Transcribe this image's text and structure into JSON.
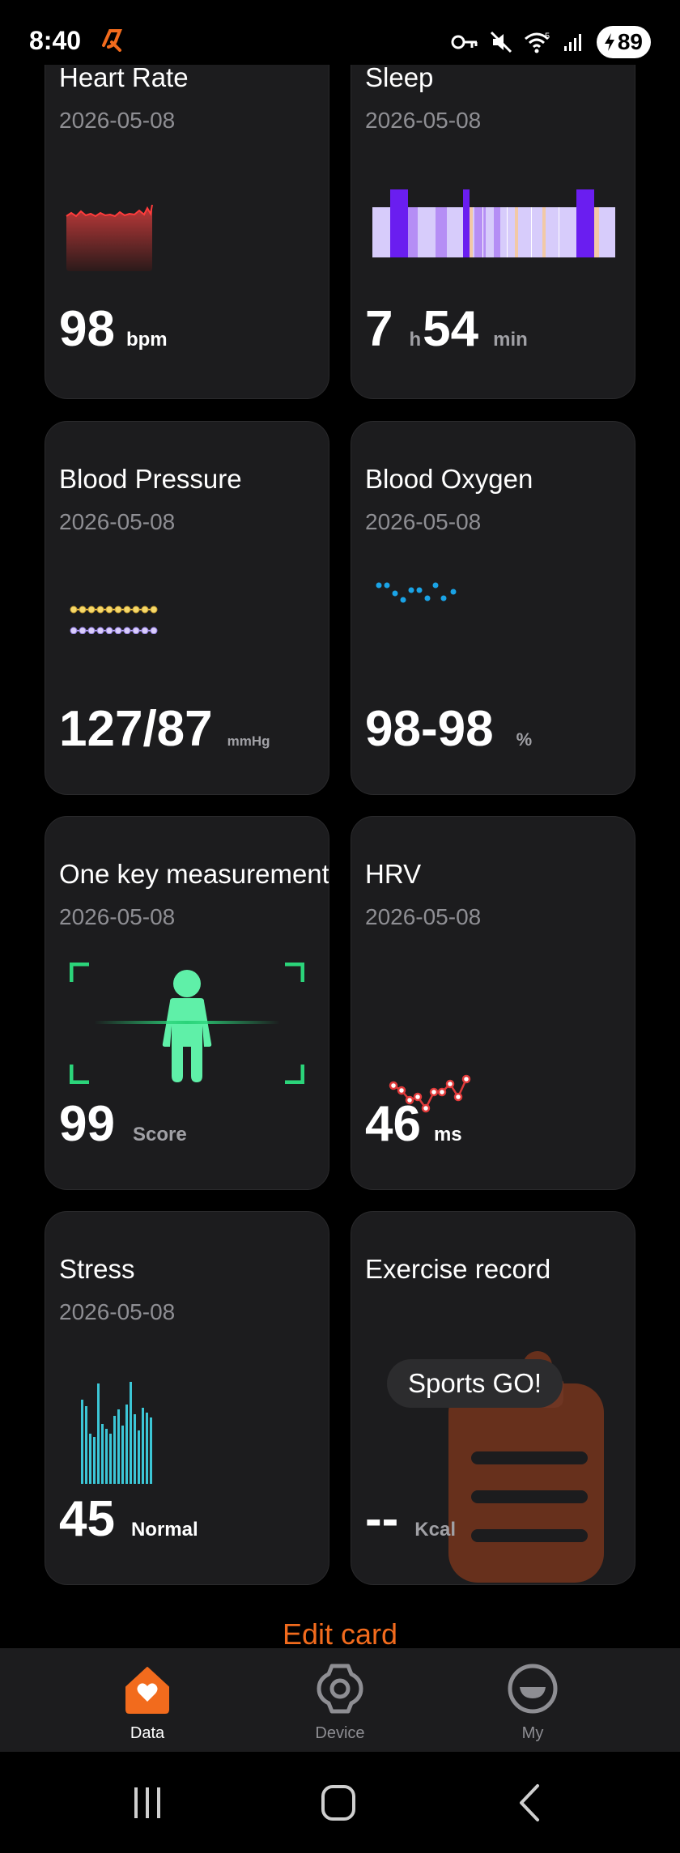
{
  "status": {
    "time": "8:40",
    "battery": "89",
    "network": "5"
  },
  "cards": {
    "heart_rate": {
      "title": "Heart Rate",
      "date": "2026-05-08",
      "value": "98",
      "unit": "bpm"
    },
    "sleep": {
      "title": "Sleep",
      "date": "2026-05-08",
      "hours": "7",
      "h_unit": "h",
      "minutes": "54",
      "min_unit": "min"
    },
    "blood_pressure": {
      "title": "Blood Pressure",
      "date": "2026-05-08",
      "value": "127/87",
      "unit": "mmHg"
    },
    "blood_oxygen": {
      "title": "Blood Oxygen",
      "date": "2026-05-08",
      "value": "98-98",
      "unit": "%"
    },
    "one_key": {
      "title": "One key measurement",
      "date": "2026-05-08",
      "value": "99",
      "unit": "Score"
    },
    "hrv": {
      "title": "HRV",
      "date": "2026-05-08",
      "value": "46",
      "unit": "ms"
    },
    "stress": {
      "title": "Stress",
      "date": "2026-05-08",
      "value": "45",
      "unit": "Normal"
    },
    "exercise": {
      "title": "Exercise record",
      "value": "--",
      "unit": "Kcal",
      "badge": "Sports GO!"
    }
  },
  "edit_card": "Edit card",
  "tabs": [
    {
      "label": "Data",
      "icon": "home-heart-icon",
      "active": true
    },
    {
      "label": "Device",
      "icon": "watch-icon",
      "active": false
    },
    {
      "label": "My",
      "icon": "profile-face-icon",
      "active": false
    }
  ],
  "colors": {
    "accent": "#f26b1d",
    "card_bg": "#1c1c1e",
    "sleep_deep": "#6a1ef0",
    "sleep_light": "#d7ccfb",
    "spo2_dot": "#1aa3e6",
    "hrv_line": "#e03a3a",
    "stress_bar": "#3cc6d6",
    "body_green": "#5ff0a8"
  }
}
